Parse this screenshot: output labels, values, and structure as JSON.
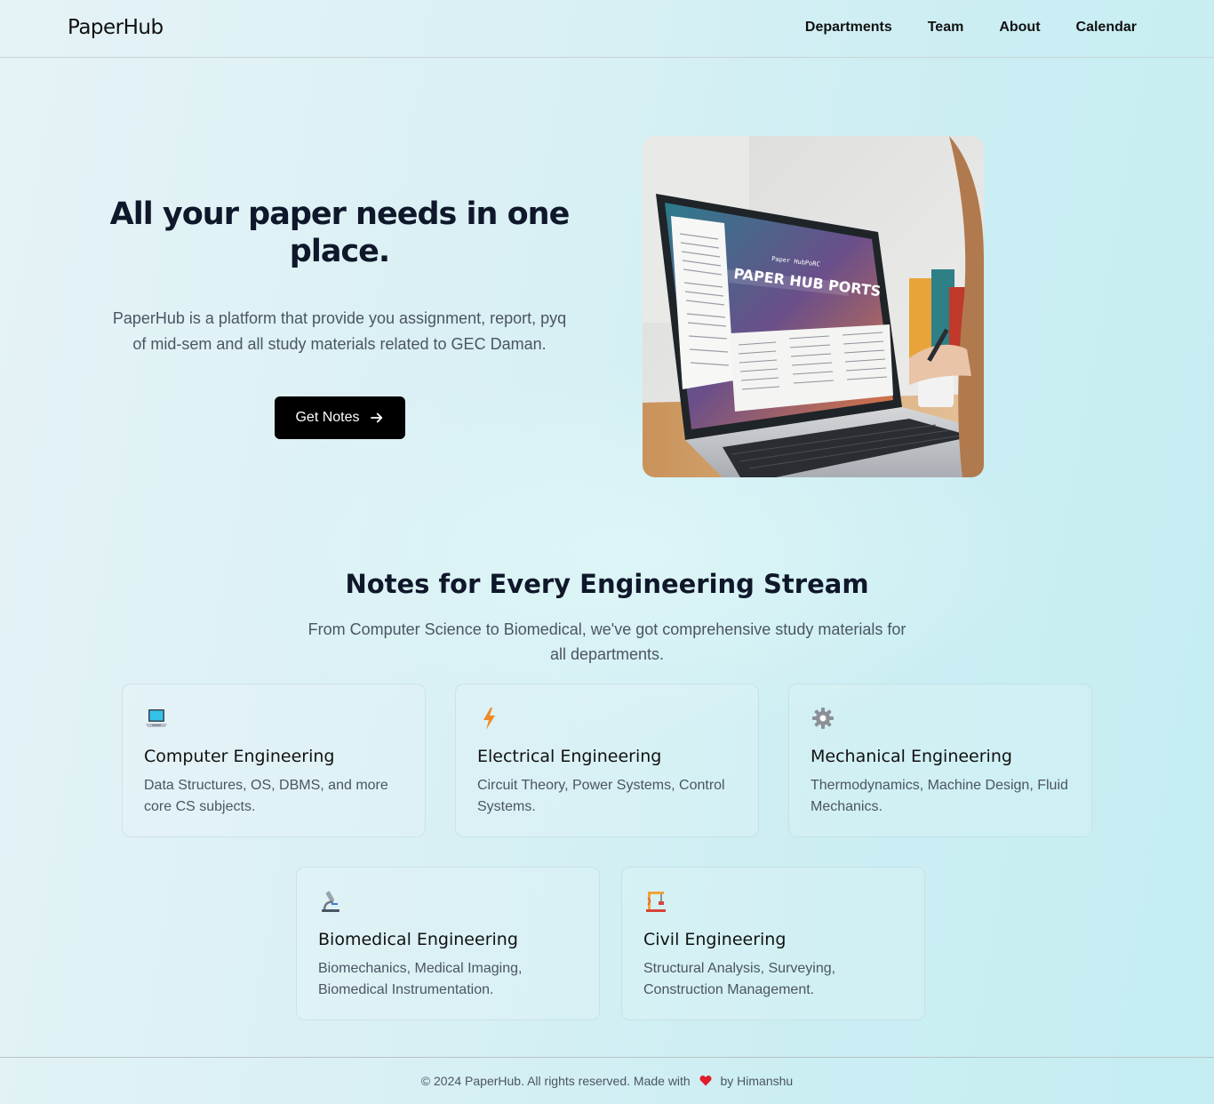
{
  "header": {
    "logo": "PaperHub",
    "nav": [
      "Departments",
      "Team",
      "About",
      "Calendar"
    ]
  },
  "hero": {
    "title": "All your paper needs in one place.",
    "description": "PaperHub is a platform that provide you assignment, report, pyq of mid-sem and all study materials related to GEC Daman.",
    "cta_label": "Get Notes",
    "image": {
      "screen_title": "PAPER HUB PORTS",
      "screen_subtitle": "Paper HubPoRC"
    }
  },
  "streams": {
    "title": "Notes for Every Engineering Stream",
    "description": "From Computer Science to Biomedical, we've got comprehensive study materials for all departments.",
    "cards": [
      {
        "icon": "laptop-icon",
        "title": "Computer Engineering",
        "desc": "Data Structures, OS, DBMS, and more core CS subjects."
      },
      {
        "icon": "lightning-icon",
        "title": "Electrical Engineering",
        "desc": "Circuit Theory, Power Systems, Control Systems."
      },
      {
        "icon": "gear-icon",
        "title": "Mechanical Engineering",
        "desc": "Thermodynamics, Machine Design, Fluid Mechanics."
      },
      {
        "icon": "microscope-icon",
        "title": "Biomedical Engineering",
        "desc": "Biomechanics, Medical Imaging, Biomedical Instrumentation."
      },
      {
        "icon": "construction-icon",
        "title": "Civil Engineering",
        "desc": "Structural Analysis, Surveying, Construction Management."
      }
    ]
  },
  "footer": {
    "text_before": "© 2024 PaperHub. All rights reserved. Made with",
    "text_after": "by Himanshu",
    "heart_color": "#e11d2b"
  }
}
